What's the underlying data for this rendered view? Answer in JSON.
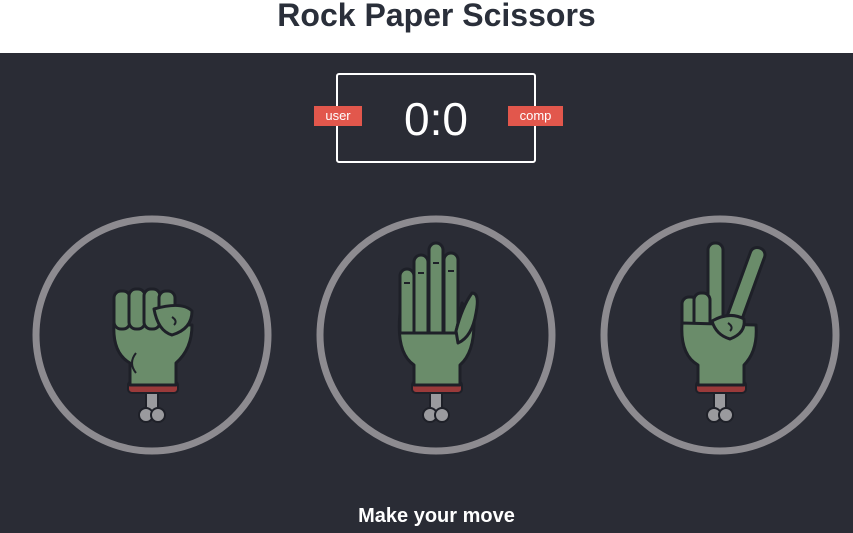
{
  "page": {
    "title": "Rock Paper Scissors"
  },
  "scoreboard": {
    "user_label": "user",
    "comp_label": "comp",
    "user_score": 0,
    "comp_score": 0,
    "display": "0:0",
    "badge_color": "#e2574c"
  },
  "choices": [
    {
      "id": "rock",
      "icon": "zombie-fist-icon"
    },
    {
      "id": "paper",
      "icon": "zombie-open-hand-icon"
    },
    {
      "id": "scissors",
      "icon": "zombie-peace-hand-icon"
    }
  ],
  "message": {
    "text": "Make your move"
  },
  "colors": {
    "background": "#2a2c35",
    "circle": "#8d8b90",
    "skin": "#6a8c6a",
    "bone": "#9a9a9e",
    "blood": "#9a3a3a",
    "title_text": "#2a2f3a"
  }
}
